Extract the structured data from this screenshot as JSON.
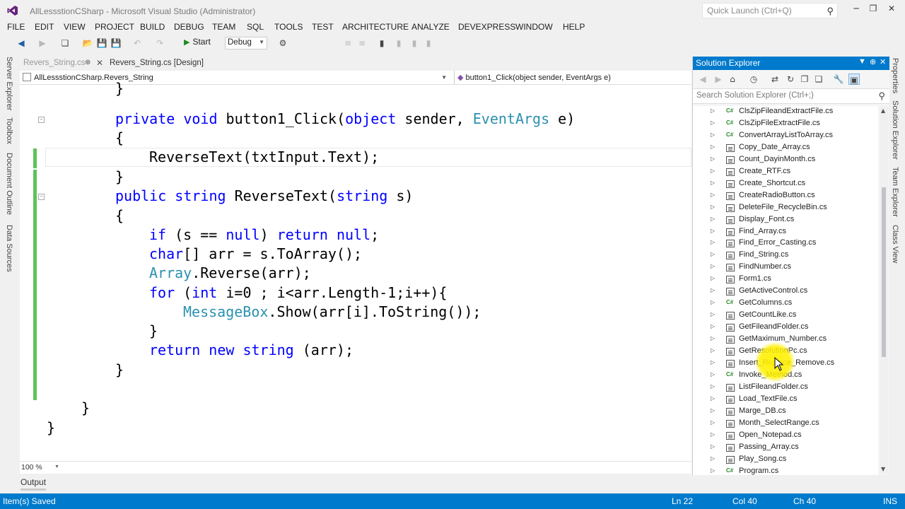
{
  "window": {
    "title": "AllLessstionCSharp - Microsoft Visual Studio (Administrator)",
    "quick_launch_placeholder": "Quick Launch (Ctrl+Q)"
  },
  "menu": [
    "FILE",
    "EDIT",
    "VIEW",
    "PROJECT",
    "BUILD",
    "DEBUG",
    "TEAM",
    "SQL",
    "TOOLS",
    "TEST",
    "ARCHITECTURE",
    "ANALYZE",
    "DEVEXPRESS",
    "WINDOW",
    "HELP"
  ],
  "toolbar": {
    "start_label": "Start",
    "config_value": "Debug"
  },
  "side_tabs": [
    "Server Explorer",
    "Toolbox",
    "Document Outline",
    "Data Sources"
  ],
  "right_tabs": [
    "Properties",
    "Solution Explorer",
    "Team Explorer",
    "Class View"
  ],
  "doc_tabs": {
    "tab1": "Revers_String.cs",
    "tab2": "Revers_String.cs [Design]"
  },
  "nav": {
    "type": "AllLessstionCSharp.Revers_String",
    "member": "button1_Click(object sender, EventArgs e)"
  },
  "code": {
    "l0": "}",
    "l1_kw1": "private",
    "l1_kw2": "void",
    "l1_txt1": " button1_Click(",
    "l1_kw3": "object",
    "l1_txt2": " sender, ",
    "l1_ty": "EventArgs",
    "l1_txt3": " e)",
    "l2": "{",
    "l3": "ReverseText(txtInput.Text);",
    "l4": "}",
    "l5_kw1": "public",
    "l5_kw2": "string",
    "l5_txt1": " ReverseText(",
    "l5_kw3": "string",
    "l5_txt2": " s)",
    "l6": "{",
    "l7_kw1": "if",
    "l7_txt1": " (s == ",
    "l7_kw2": "null",
    "l7_txt2": ") ",
    "l7_kw3": "return",
    "l7_kw4": "null",
    "l7_txt3": ";",
    "l8_kw1": "char",
    "l8_txt": "[] arr = s.ToArray();",
    "l9_ty": "Array",
    "l9_txt": ".Reverse(arr);",
    "l10_kw1": "for",
    "l10_txt1": " (",
    "l10_kw2": "int",
    "l10_txt2": " i=0 ; i<arr.Length-1;i++){",
    "l11_ty": "MessageBox",
    "l11_txt": ".Show(arr[i].ToString());",
    "l12": "}",
    "l13_kw1": "return",
    "l13_kw2": "new",
    "l13_kw3": "string",
    "l13_txt": " (arr);",
    "l14": "}",
    "l15": "}",
    "l16": "}"
  },
  "zoom": "100 %",
  "output_tab": "Output",
  "solution_explorer": {
    "title": "Solution Explorer",
    "search_placeholder": "Search Solution Explorer (Ctrl+;)",
    "items": [
      {
        "label": "ClsZipFileandExtractFile.cs",
        "icon": "csharp-class-icon"
      },
      {
        "label": "ClsZipFileExtractFile.cs",
        "icon": "csharp-class-icon"
      },
      {
        "label": "ConvertArrayListToArray.cs",
        "icon": "csharp-class-icon"
      },
      {
        "label": "Copy_Date_Array.cs",
        "icon": "form-icon"
      },
      {
        "label": "Count_DayinMonth.cs",
        "icon": "form-icon"
      },
      {
        "label": "Create_RTF.cs",
        "icon": "form-icon"
      },
      {
        "label": "Create_Shortcut.cs",
        "icon": "form-icon"
      },
      {
        "label": "CreateRadioButton.cs",
        "icon": "form-icon"
      },
      {
        "label": "DeleteFile_RecycleBin.cs",
        "icon": "form-icon"
      },
      {
        "label": "Display_Font.cs",
        "icon": "form-icon"
      },
      {
        "label": "Find_Array.cs",
        "icon": "form-icon"
      },
      {
        "label": "Find_Error_Casting.cs",
        "icon": "form-icon"
      },
      {
        "label": "Find_String.cs",
        "icon": "form-icon"
      },
      {
        "label": "FindNumber.cs",
        "icon": "form-icon"
      },
      {
        "label": "Form1.cs",
        "icon": "form-icon"
      },
      {
        "label": "GetActiveControl.cs",
        "icon": "form-icon"
      },
      {
        "label": "GetColumns.cs",
        "icon": "csharp-class-icon"
      },
      {
        "label": "GetCountLike.cs",
        "icon": "form-icon"
      },
      {
        "label": "GetFileandFolder.cs",
        "icon": "form-icon"
      },
      {
        "label": "GetMaximum_Number.cs",
        "icon": "form-icon"
      },
      {
        "label": "GetResolutionPc.cs",
        "icon": "form-icon"
      },
      {
        "label": "Insert_Replace_Remove.cs",
        "icon": "form-icon"
      },
      {
        "label": "Invoke_Method.cs",
        "icon": "csharp-class-icon"
      },
      {
        "label": "ListFileandFolder.cs",
        "icon": "form-icon"
      },
      {
        "label": "Load_TextFile.cs",
        "icon": "form-icon"
      },
      {
        "label": "Marge_DB.cs",
        "icon": "form-icon"
      },
      {
        "label": "Month_SelectRange.cs",
        "icon": "form-icon"
      },
      {
        "label": "Open_Notepad.cs",
        "icon": "form-icon"
      },
      {
        "label": "Passing_Array.cs",
        "icon": "form-icon"
      },
      {
        "label": "Play_Song.cs",
        "icon": "form-icon"
      },
      {
        "label": "Program.cs",
        "icon": "csharp-class-icon"
      }
    ]
  },
  "status": {
    "message": "Item(s) Saved",
    "ln": "Ln 22",
    "col": "Col 40",
    "ch": "Ch 40",
    "mode": "INS"
  },
  "colors": {
    "accent": "#007acc",
    "keyword": "#0000ff",
    "type": "#2b91af",
    "change_bar": "#5bc45b"
  }
}
